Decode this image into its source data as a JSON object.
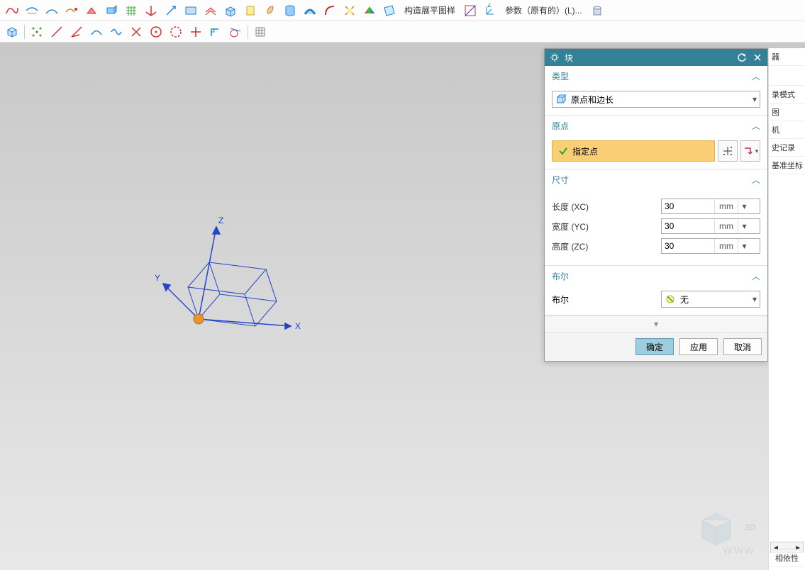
{
  "toolbar1": {
    "label_flatpattern": "构造展平图样",
    "label_params": "参数（原有的）(L)..."
  },
  "viewport": {
    "axis_x": "X",
    "axis_y": "Y",
    "axis_z": "Z"
  },
  "dialog": {
    "title": "块",
    "sections": {
      "type": {
        "header": "类型",
        "value": "原点和边长"
      },
      "origin": {
        "header": "原点",
        "label": "指定点"
      },
      "dims": {
        "header": "尺寸",
        "rows": [
          {
            "label": "长度 (XC)",
            "value": "30",
            "unit": "mm"
          },
          {
            "label": "宽度 (YC)",
            "value": "30",
            "unit": "mm"
          },
          {
            "label": "高度 (ZC)",
            "value": "30",
            "unit": "mm"
          }
        ]
      },
      "bool": {
        "header": "布尔",
        "label": "布尔",
        "value": "无"
      }
    },
    "buttons": {
      "ok": "确定",
      "apply": "应用",
      "cancel": "取消"
    }
  },
  "right_panel": {
    "items": [
      "器",
      "录模式",
      "图",
      "机",
      "史记录",
      "基准坐标"
    ],
    "footer": "相依性"
  },
  "watermark": {
    "text": "3D",
    "sub": "WWW"
  }
}
